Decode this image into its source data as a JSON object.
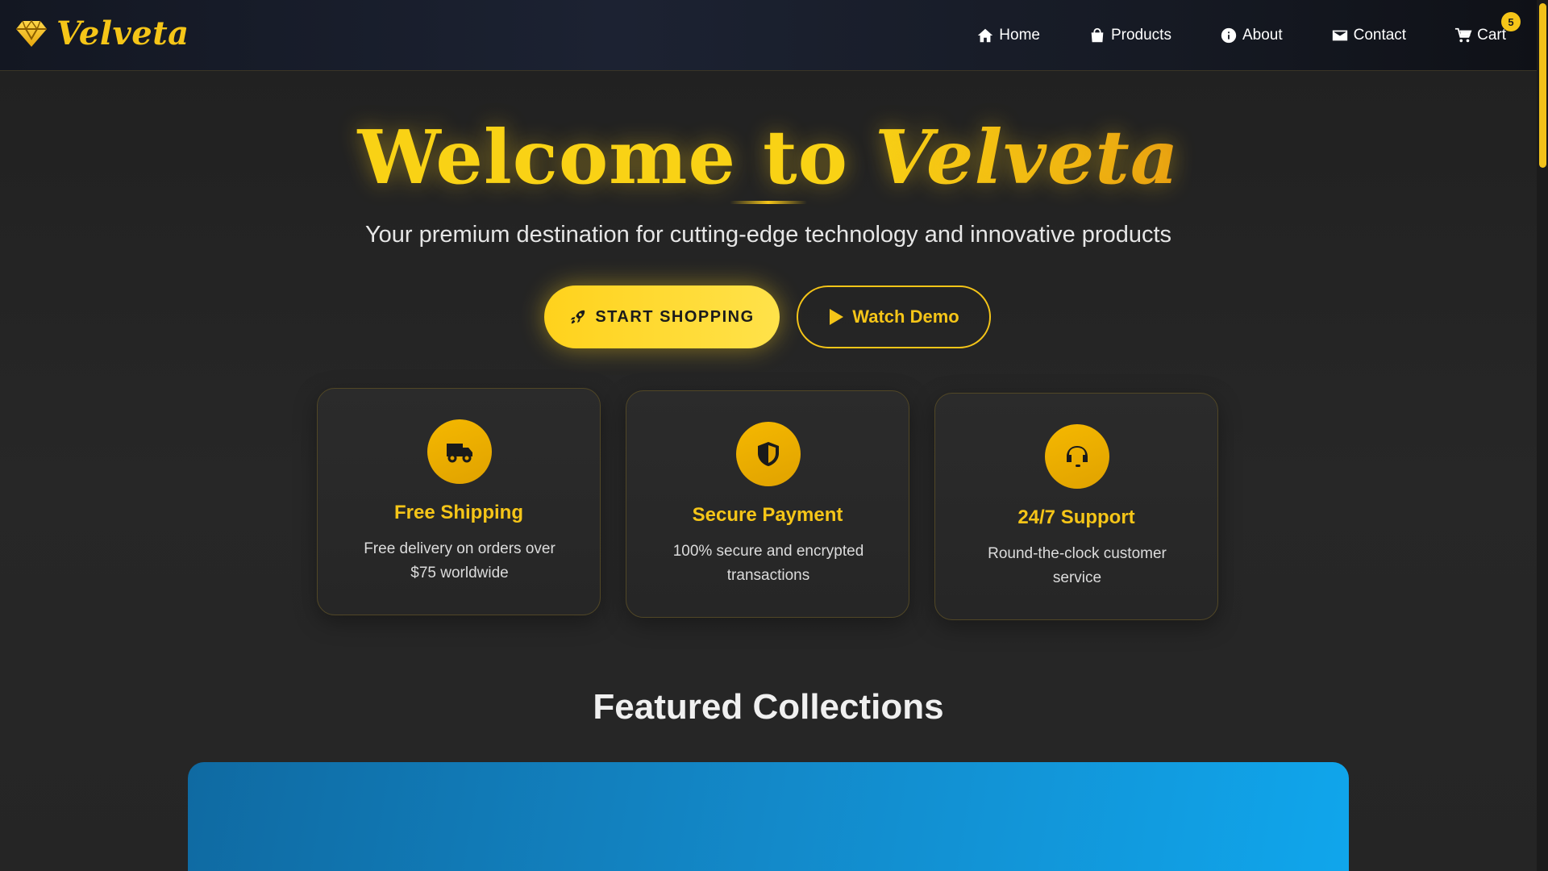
{
  "brand": {
    "name": "Velveta",
    "icon": "gem-icon",
    "accent_color": "#f5c518"
  },
  "nav": {
    "items": [
      {
        "label": "Home",
        "icon": "home-icon"
      },
      {
        "label": "Products",
        "icon": "shopping-bag-icon"
      },
      {
        "label": "About",
        "icon": "info-icon"
      },
      {
        "label": "Contact",
        "icon": "envelope-icon"
      },
      {
        "label": "Cart",
        "icon": "cart-icon",
        "badge": "5"
      }
    ]
  },
  "hero": {
    "title_prefix": "Welcome to ",
    "title_accent": "Velveta",
    "subtitle": "Your premium destination for cutting-edge technology and innovative products",
    "primary_button": {
      "label": "START SHOPPING",
      "icon": "rocket-icon"
    },
    "secondary_button": {
      "label": "Watch Demo",
      "icon": "play-icon"
    }
  },
  "features": [
    {
      "title": "Free Shipping",
      "text": "Free delivery on orders over $75 worldwide",
      "icon": "truck-icon"
    },
    {
      "title": "Secure Payment",
      "text": "100% secure and encrypted transactions",
      "icon": "shield-icon"
    },
    {
      "title": "24/7 Support",
      "text": "Round-the-clock customer service",
      "icon": "headset-icon"
    }
  ],
  "featured": {
    "title": "Featured Collections",
    "banner_color": "#1389c9"
  }
}
